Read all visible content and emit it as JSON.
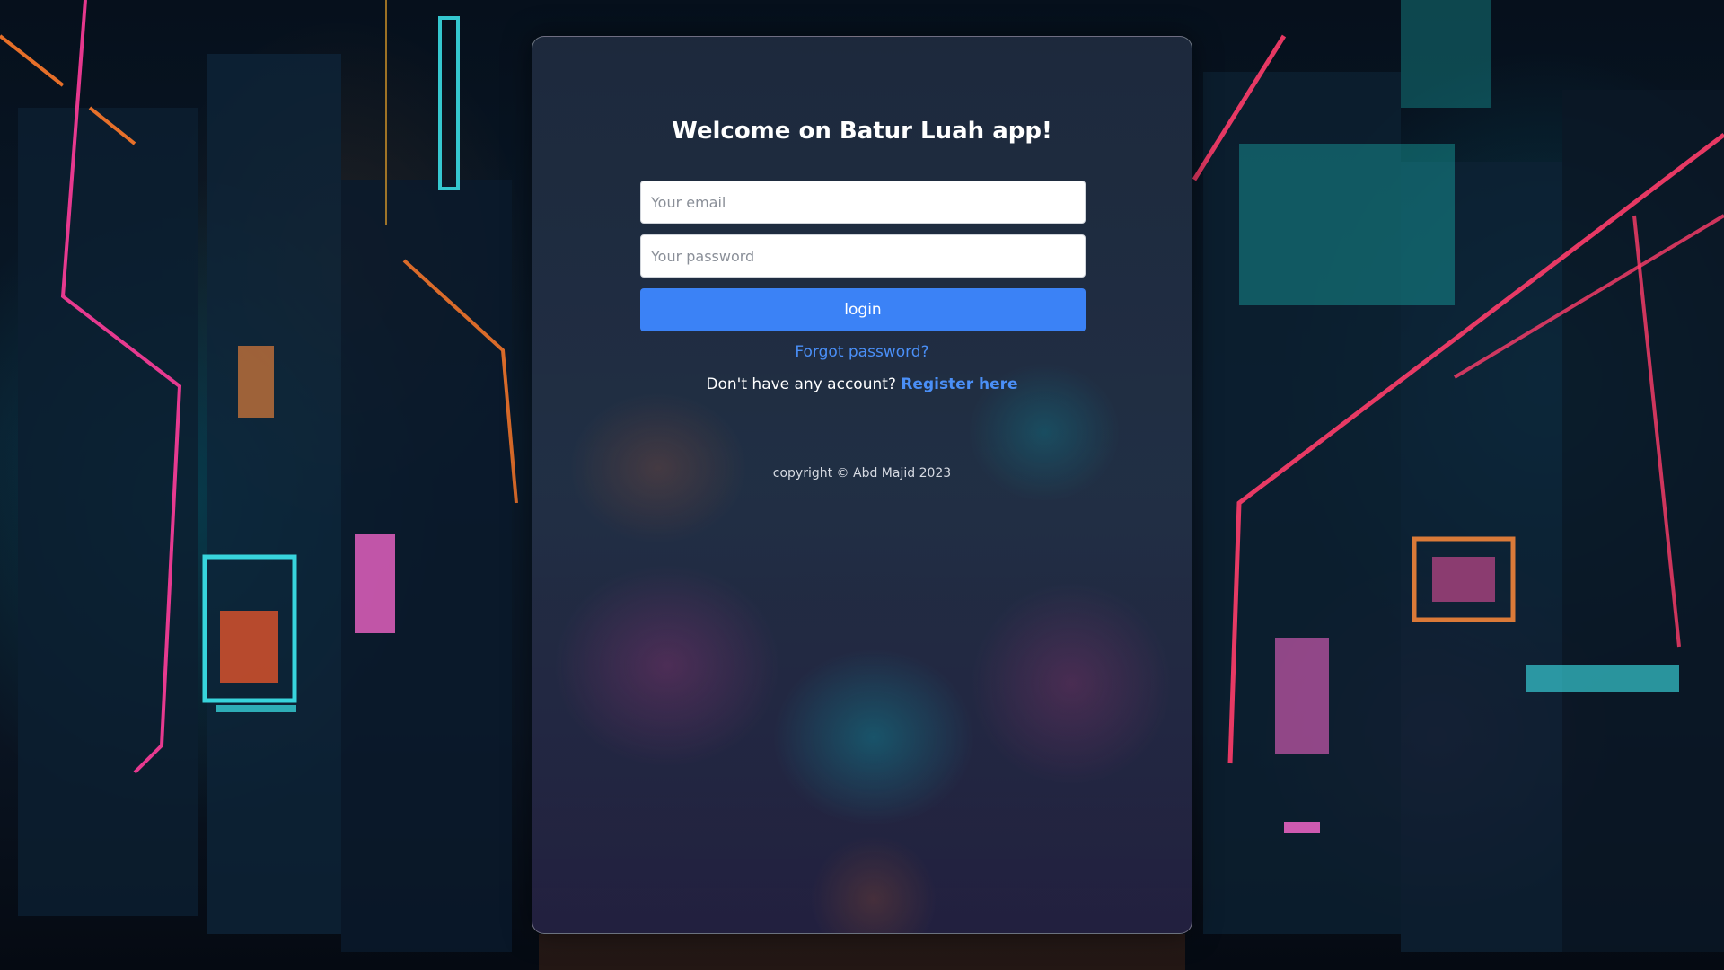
{
  "login_card": {
    "title": "Welcome on Batur Luah app!",
    "email_placeholder": "Your email",
    "email_value": "",
    "password_placeholder": "Your password",
    "password_value": "",
    "login_label": "login",
    "forgot_password_label": "Forgot password?",
    "no_account_text": "Don't have any account?",
    "register_label": "Register here",
    "copyright_text": "copyright © Abd Majid 2023"
  },
  "colors": {
    "primary_button": "#3b82f6",
    "link": "#4a8ff7",
    "card_background": "#1f2b40"
  }
}
